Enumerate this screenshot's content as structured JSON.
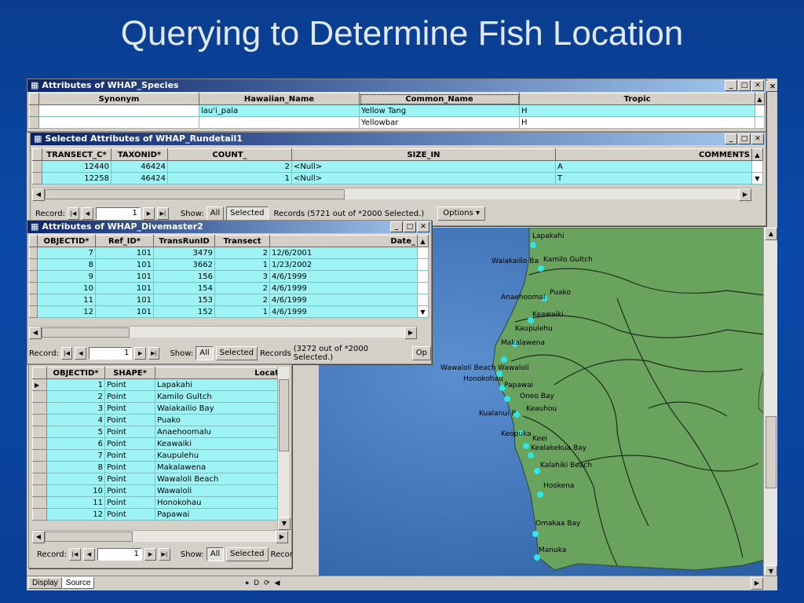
{
  "slide_title": "Querying to Determine Fish Location",
  "colors": {
    "selected_row": "#9ef3f5",
    "land": "#6aa35e",
    "ocean": "#3f74b8",
    "fish_point": "#2ee6e6"
  },
  "win_species": {
    "title": "Attributes of WHAP_Species",
    "columns": [
      "Synonym",
      "Hawaiian_Name",
      "Common_Name",
      "Tropic"
    ],
    "rows": [
      [
        "",
        "lau'i_pala",
        "Yellow Tang",
        "H"
      ],
      [
        "",
        "",
        "Yellowbar",
        "H"
      ]
    ]
  },
  "win_rundetail": {
    "title": "Selected Attributes of WHAP_Rundetail1",
    "columns": [
      "TRANSECT_C*",
      "TAXONID*",
      "COUNT_",
      "SIZE_IN",
      "COMMENTS"
    ],
    "rows": [
      [
        "12440",
        "46424",
        "2",
        "<Null>",
        "A"
      ],
      [
        "12258",
        "46424",
        "1",
        "<Null>",
        "T"
      ]
    ],
    "record_label": "Record:",
    "record_value": "1",
    "show_label": "Show:",
    "show_all": "All",
    "show_selected": "Selected",
    "records_text": "Records",
    "records_count": "(5721 out of *2000 Selected.)",
    "options_label": "Options"
  },
  "win_divemaster": {
    "title": "Attributes of WHAP_Divemaster2",
    "columns": [
      "OBJECTID*",
      "Ref_ID*",
      "TransRunID",
      "Transect",
      "Date_"
    ],
    "rows": [
      [
        "7",
        "101",
        "3479",
        "2",
        "12/6/2001"
      ],
      [
        "8",
        "101",
        "3662",
        "1",
        "1/23/2002"
      ],
      [
        "9",
        "101",
        "156",
        "3",
        "4/6/1999"
      ],
      [
        "10",
        "101",
        "154",
        "2",
        "4/6/1999"
      ],
      [
        "11",
        "101",
        "153",
        "2",
        "4/6/1999"
      ],
      [
        "12",
        "101",
        "152",
        "1",
        "4/6/1999"
      ]
    ],
    "record_label": "Record:",
    "record_value": "1",
    "show_label": "Show:",
    "show_all": "All",
    "show_selected": "Selected",
    "records_text": "Records",
    "records_count": "(3272 out of *2000 Selected.)",
    "options_label": "Op"
  },
  "win_locations": {
    "columns": [
      "OBJECTID*",
      "SHAPE*",
      "Locat"
    ],
    "rows": [
      [
        "1",
        "Point",
        "Lapakahi"
      ],
      [
        "2",
        "Point",
        "Kamilo Gultch"
      ],
      [
        "3",
        "Point",
        "Waiakailio Bay"
      ],
      [
        "4",
        "Point",
        "Puako"
      ],
      [
        "5",
        "Point",
        "Anaehoomalu"
      ],
      [
        "6",
        "Point",
        "Keawaiki"
      ],
      [
        "7",
        "Point",
        "Kaupulehu"
      ],
      [
        "8",
        "Point",
        "Makalawena"
      ],
      [
        "9",
        "Point",
        "Wawaloli Beach"
      ],
      [
        "10",
        "Point",
        "Wawaloli"
      ],
      [
        "11",
        "Point",
        "Honokohau"
      ],
      [
        "12",
        "Point",
        "Papawai"
      ]
    ],
    "record_label": "Record:",
    "record_value": "1",
    "show_label": "Show:",
    "show_all": "All",
    "show_selected": "Selected",
    "records_text": "Recor"
  },
  "tabs": {
    "display": "Display",
    "source": "Source"
  },
  "map_labels": {
    "lapakahi": "Lapakahi",
    "waiakailio": "Waiakailio Ba",
    "kamilo": "Kamilo Gultch",
    "anaehoomalu": "Anaehoomal",
    "puako": "Puako",
    "keawaiki": "Keawaiki",
    "kaupulehu": "Kaupulehu",
    "makalawena": "Makalawena",
    "wawaloli_beach": "Wawaloli Beach",
    "wawaloli": "Wawaloli",
    "honokohau": "Honokohau",
    "papawai": "Papawai",
    "oneo": "Oneo Bay",
    "keauhou": "Keauhou",
    "kualanui": "Kualanui P",
    "keopuka": "Keopuka",
    "keei": "Keei",
    "kealakekua": "Kealakekua Bay",
    "kalahiki": "Kalahiki Beach",
    "hookena": "Hookena",
    "omakaa": "Omakaa Bay",
    "manuka": "Manuka"
  }
}
